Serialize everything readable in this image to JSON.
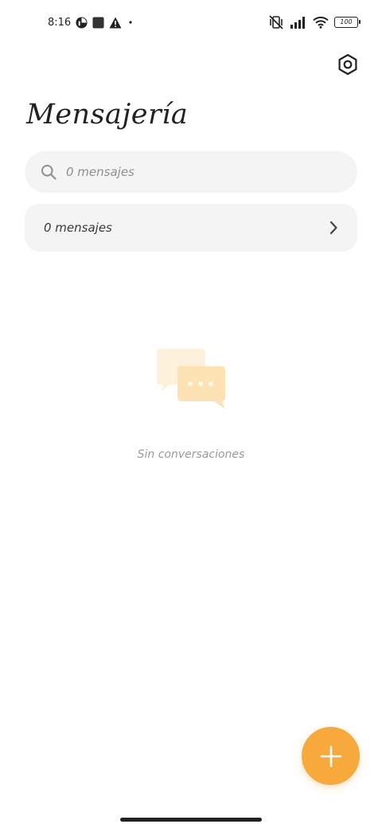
{
  "status_bar": {
    "time": "8:16",
    "left_icons": [
      "pie-notification-icon",
      "square-notification-icon",
      "warning-icon",
      "dot-icon"
    ],
    "right_icons": [
      "vibrate-off-icon",
      "signal-icon",
      "wifi-icon",
      "battery-icon"
    ],
    "battery_level": "100"
  },
  "header": {
    "title": "Mensajería",
    "settings_icon": "settings-hexagon-icon"
  },
  "search": {
    "placeholder": "0 mensajes",
    "icon": "search-icon"
  },
  "messages_row": {
    "label": "0 mensajes",
    "icon": "chevron-right-icon"
  },
  "empty_state": {
    "text": "Sin conversaciones",
    "icon": "chat-bubbles-icon"
  },
  "fab": {
    "icon": "plus-icon",
    "color": "#f7a93b"
  },
  "colors": {
    "accent": "#f7a93b",
    "surface": "#f4f4f4",
    "background": "#ffffff",
    "text_primary": "#222222",
    "text_secondary": "#9a9a9a"
  }
}
